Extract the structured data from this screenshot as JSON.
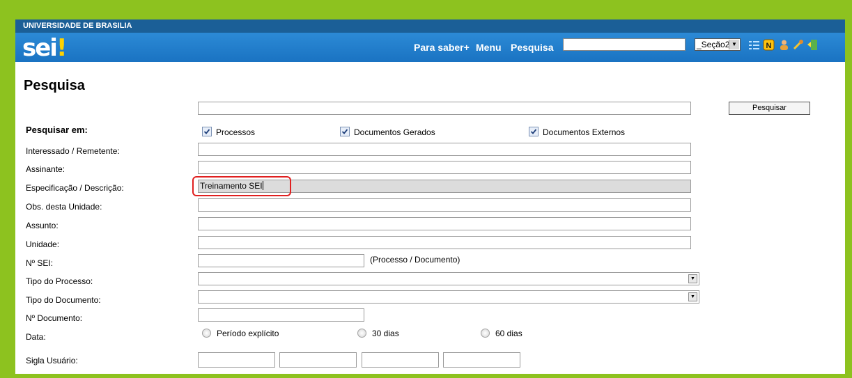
{
  "header": {
    "institution": "UNIVERSIDADE DE BRASILIA",
    "logo_text": "sei",
    "logo_mark": "!",
    "nav": [
      "Para saber+",
      "Menu",
      "Pesquisa"
    ],
    "search_value": "",
    "unit_select": "_Seção2",
    "icons": [
      "list-icon",
      "notes-icon",
      "user-icon",
      "tools-icon",
      "exit-icon"
    ]
  },
  "page": {
    "title": "Pesquisa",
    "search_button": "Pesquisar",
    "search_in_label": "Pesquisar em:",
    "checkboxes": [
      {
        "label": "Processos",
        "checked": true
      },
      {
        "label": "Documentos Gerados",
        "checked": true
      },
      {
        "label": "Documentos Externos",
        "checked": true
      }
    ],
    "fields": {
      "interessado": "Interessado / Remetente:",
      "assinante": "Assinante:",
      "especificacao": "Especificação / Descrição:",
      "especificacao_value": "Treinamento SEI",
      "obs": "Obs. desta Unidade:",
      "assunto": "Assunto:",
      "unidade": "Unidade:",
      "nsei": "Nº SEI:",
      "nsei_hint": "(Processo / Documento)",
      "tipo_processo": "Tipo do Processo:",
      "tipo_documento": "Tipo do Documento:",
      "ndocumento": "Nº Documento:",
      "data": "Data:",
      "sigla": "Sigla Usuário:"
    },
    "date_options": [
      "Período explícito",
      "30 dias",
      "60 dias"
    ]
  },
  "colors": {
    "border_green": "#8dc21f",
    "topbar_blue": "#1b5f97",
    "header_blue": "#1a73c2",
    "highlight_red": "#e02020"
  }
}
